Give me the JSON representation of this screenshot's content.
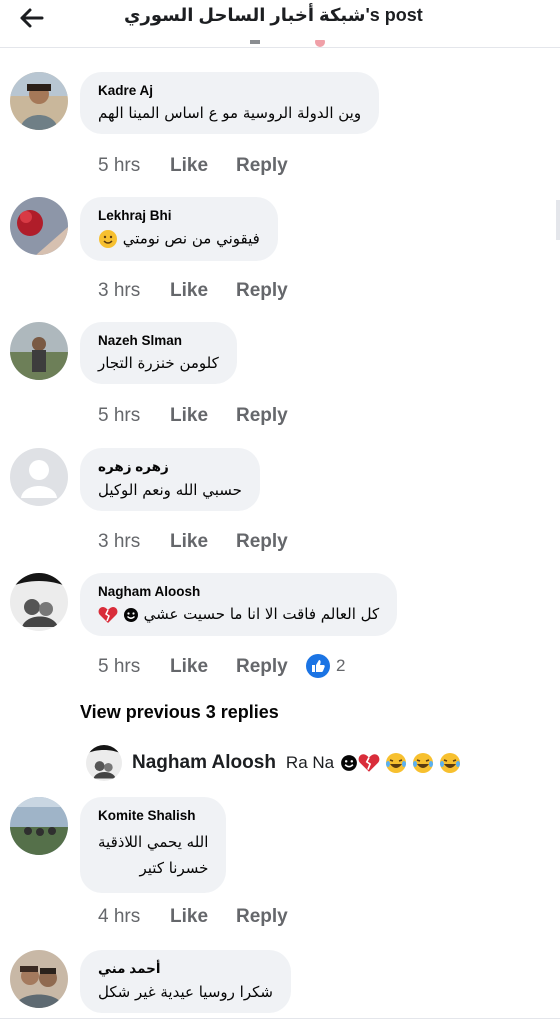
{
  "header": {
    "title": "شبكة أخبار الساحل السوري's post",
    "back_icon": "arrow-left-icon"
  },
  "comments": [
    {
      "author": "Kadre Aj",
      "text": "وين الدولة الروسية مو ع اساس المينا الهم",
      "time": "5 hrs",
      "like": "Like",
      "reply": "Reply"
    },
    {
      "author": "Lekhraj Bhi",
      "text": "فيقوني من نص نومتي",
      "time": "3 hrs",
      "like": "Like",
      "reply": "Reply"
    },
    {
      "author": "Nazeh Slman",
      "text": "كلومن خنزرة التجار",
      "time": "5 hrs",
      "like": "Like",
      "reply": "Reply"
    },
    {
      "author": "زهره زهره",
      "text": "حسبي الله ونعم الوكيل",
      "time": "3 hrs",
      "like": "Like",
      "reply": "Reply"
    },
    {
      "author": "Nagham Aloosh",
      "text": "كل العالم فاقت الا انا ما حسيت عشي",
      "time": "5 hrs",
      "like": "Like",
      "reply": "Reply",
      "reaction_count": "2"
    },
    {
      "author": "Komite Shalish",
      "text_line1": "الله يحمي اللاذقية",
      "text_line2": "خسرنا كتير",
      "time": "4 hrs",
      "like": "Like",
      "reply": "Reply"
    },
    {
      "author": "أحمد مني",
      "text": "شكرا روسيا عيدية غير شكل"
    }
  ],
  "view_previous_replies": "View previous 3 replies",
  "reply_preview": {
    "author": "Nagham Aloosh",
    "text": "Ra Na"
  },
  "colors": {
    "bubble": "#f0f2f5",
    "meta": "#65676b",
    "like_blue": "#1b74e4",
    "heart": "#d92d3a",
    "emoji_yellow": "#f7c02f"
  }
}
